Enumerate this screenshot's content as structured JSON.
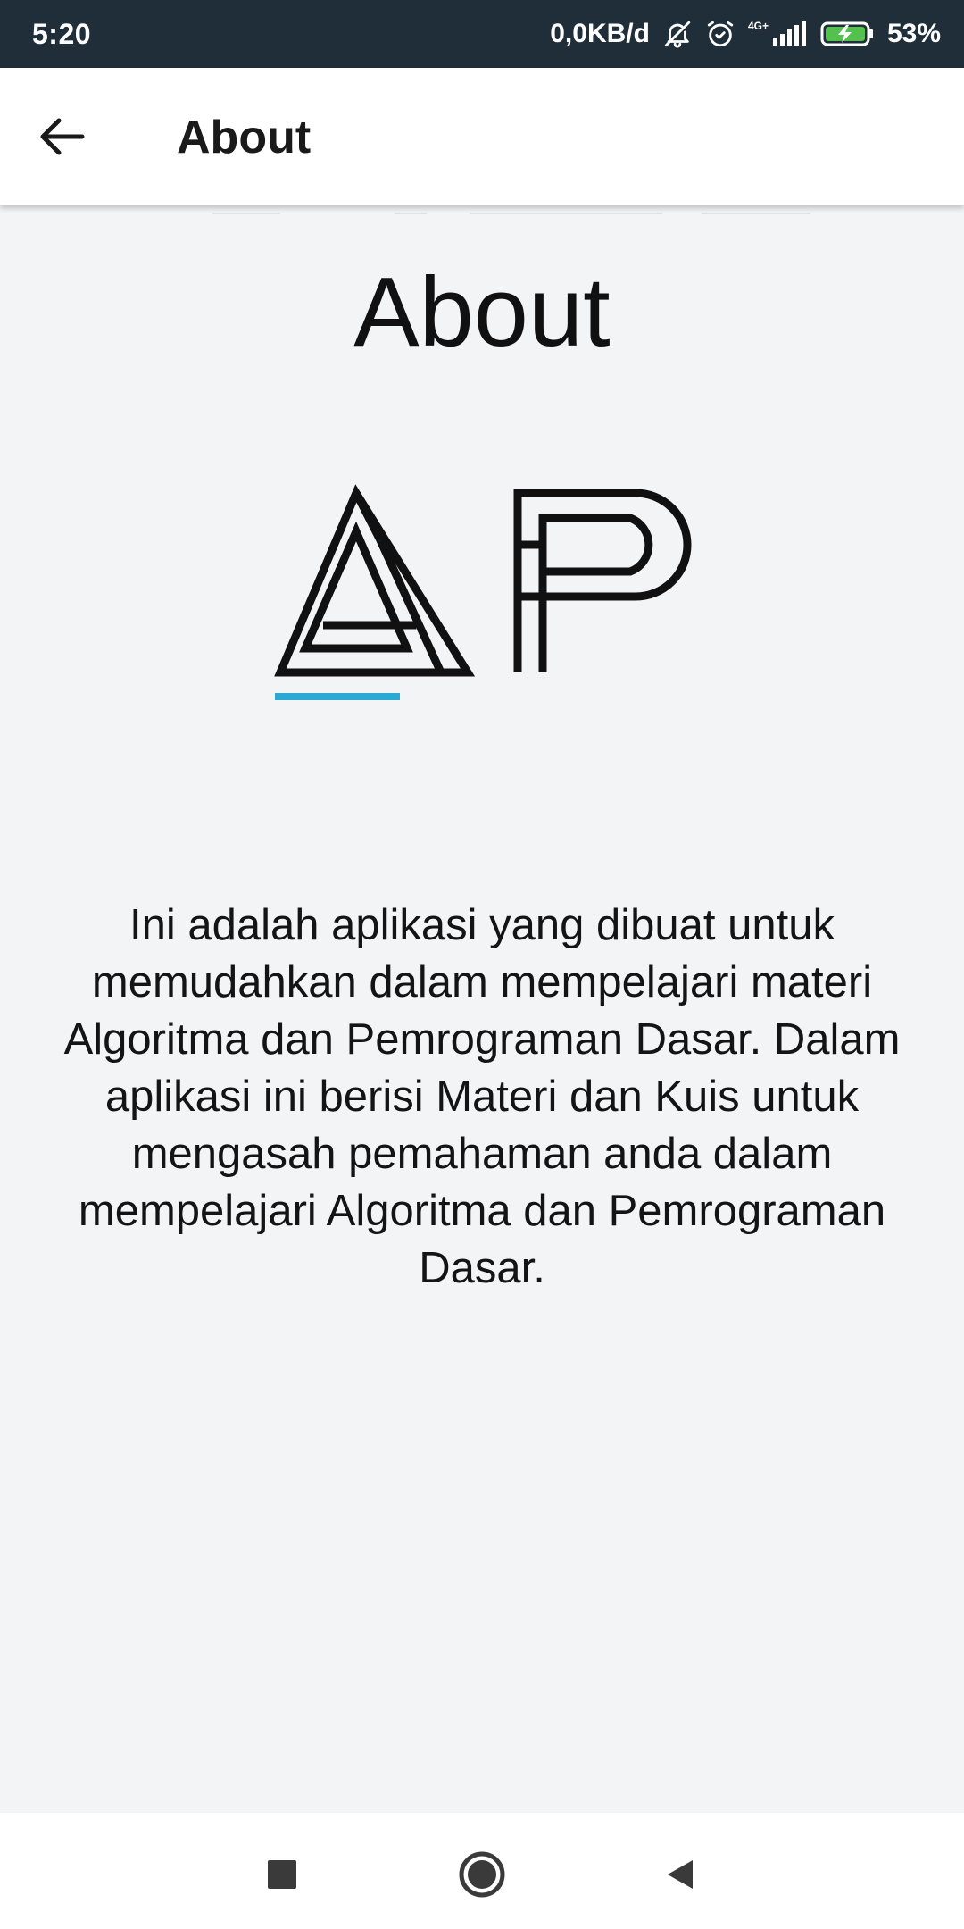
{
  "status_bar": {
    "time": "5:20",
    "network_speed": "0,0KB/d",
    "network_type": "4G+",
    "battery": "53%",
    "icons": [
      "bell-off-icon",
      "alarm-icon",
      "signal-icon",
      "battery-charging-icon"
    ]
  },
  "app_bar": {
    "title": "About",
    "back_icon": "arrow-left-icon"
  },
  "content": {
    "title": "About",
    "logo_accent_color": "#2aa9d4",
    "description": "Ini adalah aplikasi yang dibuat untuk memudahkan dalam mempelajari materi Algoritma dan Pemrograman Dasar. Dalam aplikasi ini berisi Materi dan Kuis untuk mengasah pemahaman anda dalam mempelajari Algoritma dan Pemrograman Dasar."
  },
  "nav_bar": {
    "icons": [
      "recents-square-icon",
      "home-circle-icon",
      "back-triangle-icon"
    ]
  }
}
